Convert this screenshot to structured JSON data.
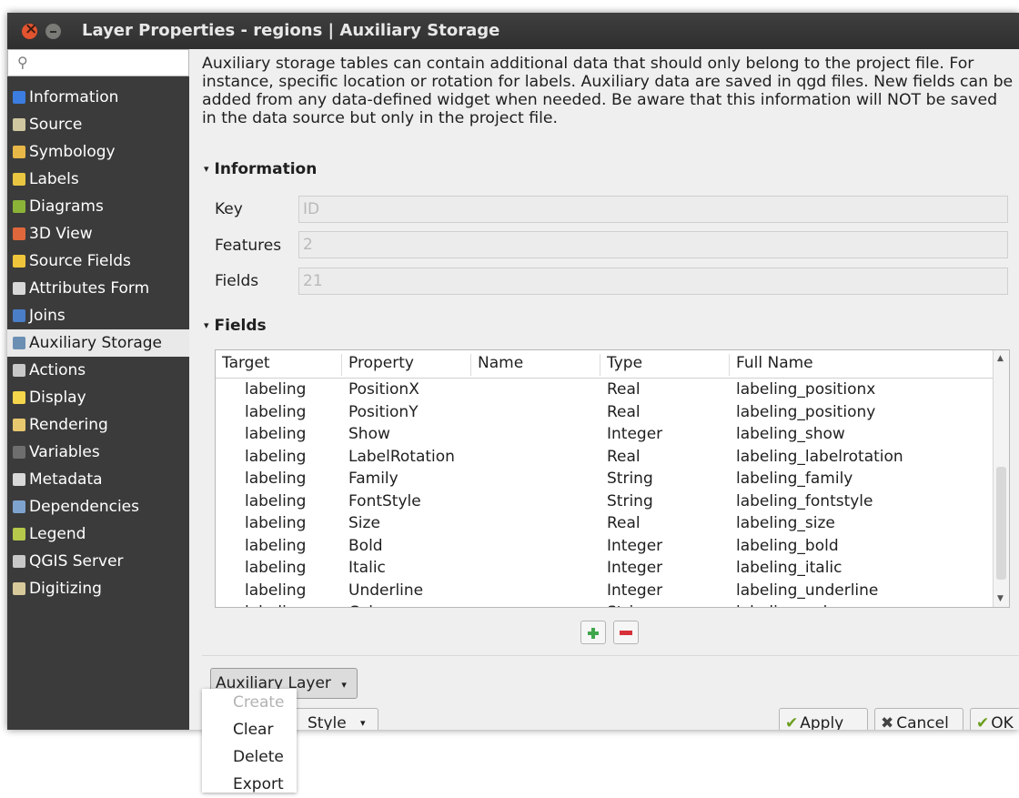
{
  "window": {
    "title": "Layer Properties - regions | Auxiliary Storage"
  },
  "search": {
    "icon": "search-icon"
  },
  "nav": [
    {
      "label": "Information",
      "icon": "information-icon",
      "color": "#3b7de0"
    },
    {
      "label": "Source",
      "icon": "source-icon",
      "color": "#d0c7a0"
    },
    {
      "label": "Symbology",
      "icon": "symbology-icon",
      "color": "#e7b847"
    },
    {
      "label": "Labels",
      "icon": "labels-icon",
      "color": "#e9c541"
    },
    {
      "label": "Diagrams",
      "icon": "diagrams-icon",
      "color": "#8bb337"
    },
    {
      "label": "3D View",
      "icon": "3d-view-icon",
      "color": "#e0673b"
    },
    {
      "label": "Source Fields",
      "icon": "source-fields-icon",
      "color": "#efc63b"
    },
    {
      "label": "Attributes Form",
      "icon": "attributes-form-icon",
      "color": "#d8d8d8"
    },
    {
      "label": "Joins",
      "icon": "joins-icon",
      "color": "#4a7ec7"
    },
    {
      "label": "Auxiliary Storage",
      "icon": "auxiliary-storage-icon",
      "color": "#6b8fb3"
    },
    {
      "label": "Actions",
      "icon": "actions-icon",
      "color": "#c8c8c8"
    },
    {
      "label": "Display",
      "icon": "display-icon",
      "color": "#f4d54b"
    },
    {
      "label": "Rendering",
      "icon": "rendering-icon",
      "color": "#e8c86f"
    },
    {
      "label": "Variables",
      "icon": "variables-icon",
      "color": "#6e6e6e"
    },
    {
      "label": "Metadata",
      "icon": "metadata-icon",
      "color": "#d8d8d8"
    },
    {
      "label": "Dependencies",
      "icon": "dependencies-icon",
      "color": "#7fa3cf"
    },
    {
      "label": "Legend",
      "icon": "legend-icon",
      "color": "#b7c94b"
    },
    {
      "label": "QGIS Server",
      "icon": "qgis-server-icon",
      "color": "#c8c8c8"
    },
    {
      "label": "Digitizing",
      "icon": "digitizing-icon",
      "color": "#d8c99a"
    }
  ],
  "description": "Auxiliary storage tables can contain additional data that should only belong to the project file. For instance, specific location or rotation for labels. Auxiliary data are saved in qgd files. New fields can be added from any data-defined widget when needed. Be aware that this information will NOT be saved in the data source but only in the project file.",
  "info": {
    "header": "Information",
    "key_label": "Key",
    "key_value": "ID",
    "features_label": "Features",
    "features_value": "2",
    "fields_label": "Fields",
    "fields_value": "21"
  },
  "fields_group": {
    "header": "Fields",
    "columns": [
      "Target",
      "Property",
      "Name",
      "Type",
      "Full Name"
    ],
    "rows": [
      [
        "labeling",
        "PositionX",
        "",
        "Real",
        "labeling_positionx"
      ],
      [
        "labeling",
        "PositionY",
        "",
        "Real",
        "labeling_positiony"
      ],
      [
        "labeling",
        "Show",
        "",
        "Integer",
        "labeling_show"
      ],
      [
        "labeling",
        "LabelRotation",
        "",
        "Real",
        "labeling_labelrotation"
      ],
      [
        "labeling",
        "Family",
        "",
        "String",
        "labeling_family"
      ],
      [
        "labeling",
        "FontStyle",
        "",
        "String",
        "labeling_fontstyle"
      ],
      [
        "labeling",
        "Size",
        "",
        "Real",
        "labeling_size"
      ],
      [
        "labeling",
        "Bold",
        "",
        "Integer",
        "labeling_bold"
      ],
      [
        "labeling",
        "Italic",
        "",
        "Integer",
        "labeling_italic"
      ],
      [
        "labeling",
        "Underline",
        "",
        "Integer",
        "labeling_underline"
      ],
      [
        "labeling",
        "Color",
        "",
        "String",
        "labeling_color"
      ]
    ]
  },
  "buttons": {
    "auxiliary_layer": "Auxiliary Layer",
    "style": "Style",
    "apply": "Apply",
    "cancel": "Cancel",
    "ok": "OK"
  },
  "menu": {
    "items": [
      {
        "label": "Create",
        "enabled": false
      },
      {
        "label": "Clear",
        "enabled": true
      },
      {
        "label": "Delete",
        "enabled": true
      },
      {
        "label": "Export",
        "enabled": true
      }
    ]
  }
}
